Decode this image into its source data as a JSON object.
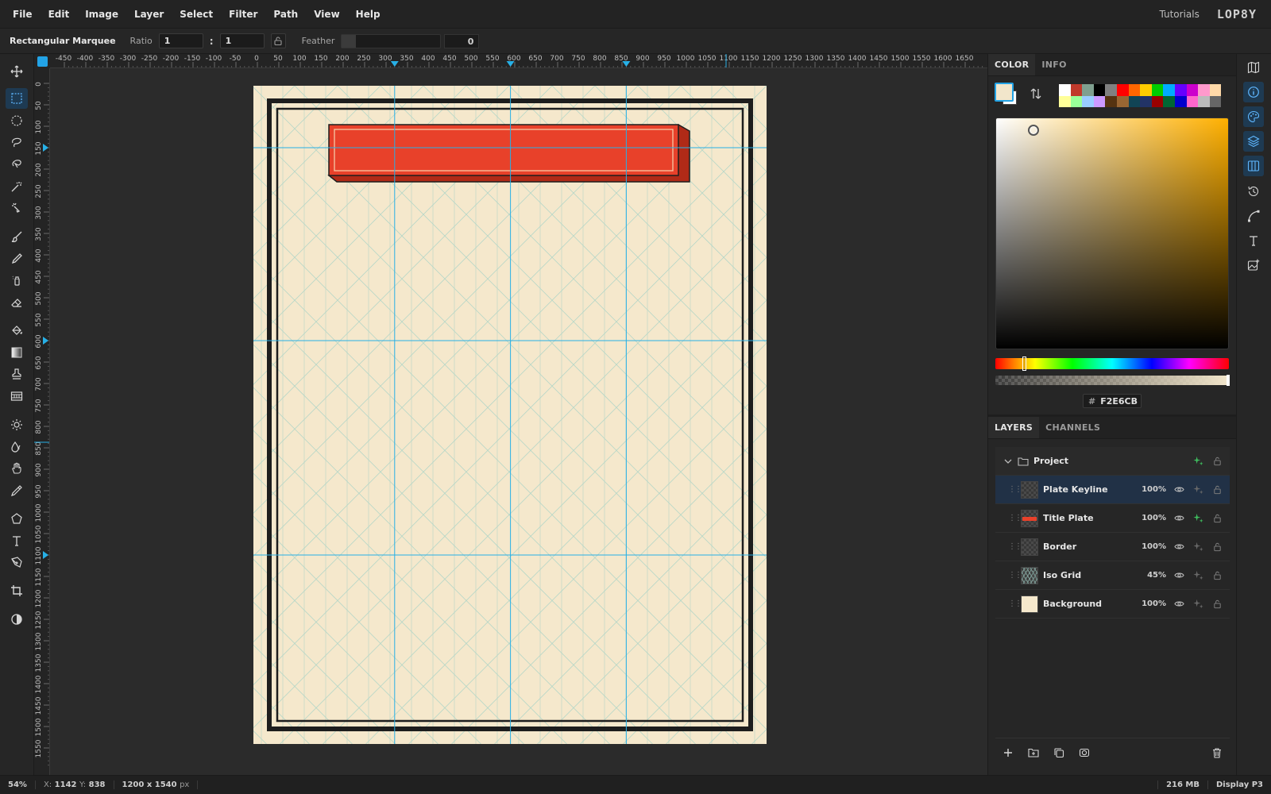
{
  "menu": {
    "items": [
      "File",
      "Edit",
      "Image",
      "Layer",
      "Select",
      "Filter",
      "Path",
      "View",
      "Help"
    ],
    "tutorials": "Tutorials",
    "logo": "LOP8Y"
  },
  "options": {
    "tool_name": "Rectangular Marquee",
    "ratio_label": "Ratio",
    "ratio_w": "1",
    "ratio_sep": ":",
    "ratio_h": "1",
    "feather_label": "Feather",
    "feather_value": "0",
    "feather_level": 0
  },
  "rulers": {
    "h_labels": [
      "-450",
      "-400",
      "-350",
      "-300",
      "-250",
      "-200",
      "-150",
      "-100",
      "-50",
      "0",
      "50",
      "100",
      "150",
      "200",
      "250",
      "300",
      "350",
      "400",
      "450",
      "500",
      "550",
      "600",
      "650",
      "700",
      "750",
      "800",
      "850",
      "900",
      "950",
      "1000",
      "1050",
      "1100",
      "1150",
      "1200",
      "1250",
      "1300",
      "1350",
      "1400",
      "1450",
      "1500",
      "1550",
      "1600",
      "1650"
    ],
    "v_labels": [
      "0",
      "50",
      "100",
      "150",
      "200",
      "250",
      "300",
      "350",
      "400",
      "450",
      "500",
      "550",
      "600",
      "650",
      "700",
      "750",
      "800",
      "850",
      "900",
      "950",
      "1000",
      "1050",
      "1100",
      "1150",
      "1200",
      "1250",
      "1300",
      "1350",
      "1400",
      "1450",
      "1500",
      "1550"
    ]
  },
  "color": {
    "tabs": [
      "COLOR",
      "INFO"
    ],
    "foreground": "#f2e6cb",
    "background": "#ffffff",
    "hex_prefix": "#",
    "hex": "F2E6CB",
    "palette": [
      "#ffffff",
      "#c0392b",
      "#7f9f8f",
      "#000000",
      "#808080",
      "#ff0000",
      "#ff6600",
      "#ffcc00",
      "#00cc00",
      "#00aaff",
      "#6600ff",
      "#cc00cc",
      "#ff99cc",
      "#ffd9a8",
      "#ffff99",
      "#99ff99",
      "#99ccff",
      "#cc99ff",
      "#553311",
      "#996633",
      "#114455",
      "#223366",
      "#990000",
      "#006633",
      "#0000cc",
      "#ff66cc",
      "#bbbbbb",
      "#666666"
    ]
  },
  "layers": {
    "tabs": [
      "LAYERS",
      "CHANNELS"
    ],
    "group": {
      "name": "Project"
    },
    "items": [
      {
        "name": "Plate Keyline",
        "opacity": "100%",
        "selected": true,
        "thumb": "transparent",
        "fx": false
      },
      {
        "name": "Title Plate",
        "opacity": "100%",
        "selected": false,
        "thumb": "plate",
        "fx": true
      },
      {
        "name": "Border",
        "opacity": "100%",
        "selected": false,
        "thumb": "transparent",
        "fx": false
      },
      {
        "name": "Iso Grid",
        "opacity": "45%",
        "selected": false,
        "thumb": "grid",
        "fx": false
      },
      {
        "name": "Background",
        "opacity": "100%",
        "selected": false,
        "thumb": "cream",
        "fx": false
      }
    ]
  },
  "document": {
    "paper_color": "#f5e8cc",
    "grid_color": "#9fd0c6",
    "guide_color": "#27b0e6",
    "plate_color": "#e8412a",
    "border_color": "#1d1d1d"
  },
  "status": {
    "zoom": "54%",
    "x_label": "X:",
    "x_value": "1142",
    "y_label": "Y:",
    "y_value": "838",
    "doc_size": "1200 x 1540",
    "doc_unit": "px",
    "memory": "216 MB",
    "profile": "Display P3"
  }
}
